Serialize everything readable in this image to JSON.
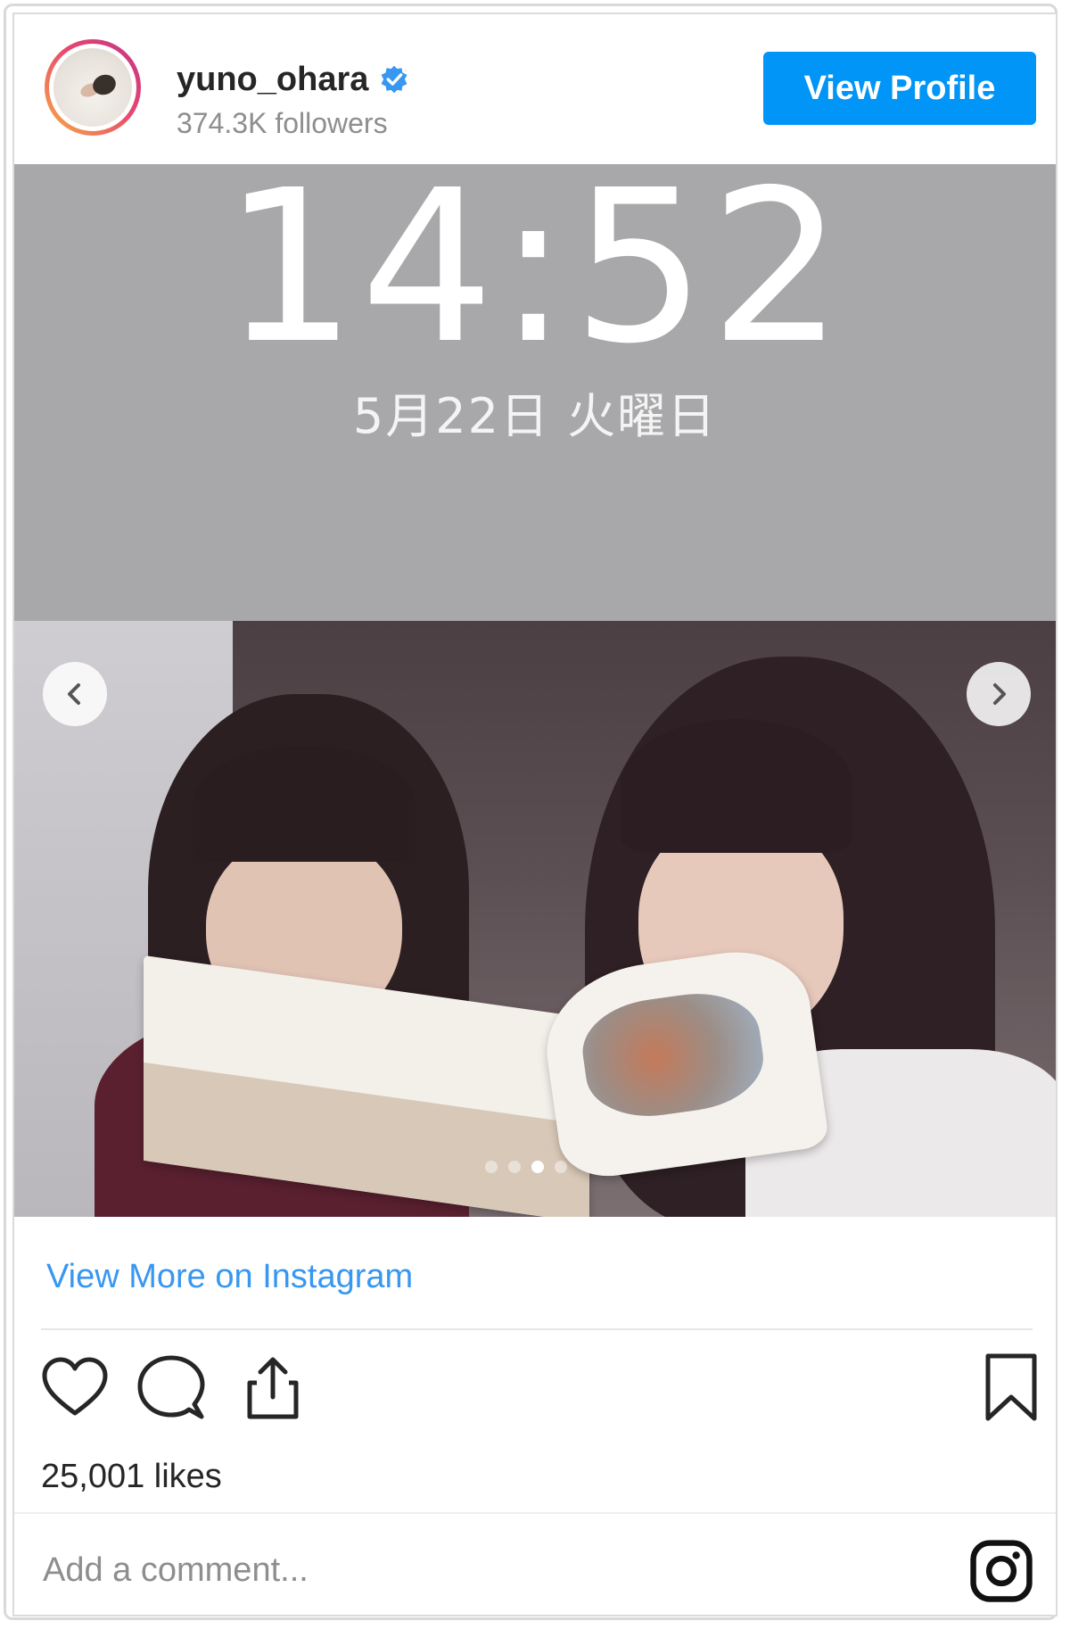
{
  "header": {
    "username": "yuno_ohara",
    "verified": true,
    "followers": "374.3K followers",
    "view_profile_label": "View Profile"
  },
  "media": {
    "clock": "14:52",
    "date": "5月22日 火曜日",
    "carousel": {
      "total": 4,
      "active": 3
    },
    "prev_icon": "chevron-left-icon",
    "next_icon": "chevron-right-icon"
  },
  "footer": {
    "view_more": "View More on Instagram",
    "likes": "25,001 likes",
    "comment_placeholder": "Add a comment..."
  },
  "icons": [
    "heart-icon",
    "comment-icon",
    "share-icon",
    "bookmark-icon",
    "instagram-icon",
    "verified-icon"
  ],
  "colors": {
    "accent": "#0095f6",
    "link": "#3897f0",
    "text": "#262626",
    "muted": "#8e8e8e"
  }
}
